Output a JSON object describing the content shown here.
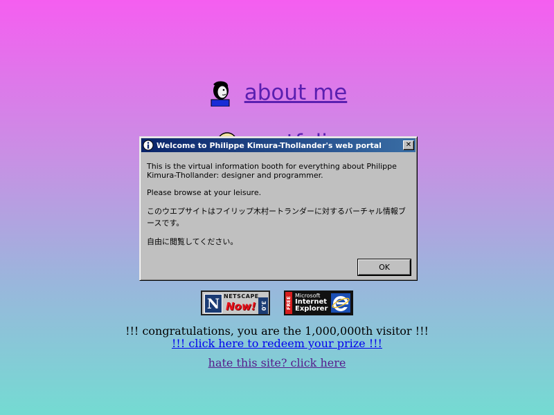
{
  "nav": {
    "about_label": "about me",
    "portfolio_label": "portfolio"
  },
  "dialog": {
    "title": "Welcome to Philippe Kimura-Thollander's web portal",
    "close_glyph": "✕",
    "paragraph_1": "This is the virtual information booth for everything about Philippe Kimura-Thollander: designer and programmer.",
    "paragraph_2": "Please browse at your leisure.",
    "paragraph_3": "このウエプサイトはフイリップ木村ートランダーに対するバーチャル情報ブースです。",
    "paragraph_4": "自由に閲覧してください。",
    "ok_label": "OK"
  },
  "badges": {
    "netscape": {
      "word": "NETSCAPE",
      "now": "Now!",
      "version": "3.0",
      "letter": "N"
    },
    "ie": {
      "free": "FREE",
      "microsoft": "Microsoft",
      "internet": "Internet",
      "explorer": "Explorer"
    }
  },
  "footer": {
    "congrats_text": "!!! congratulations, you are the 1,000,000th visitor !!!",
    "prize_link": "!!! click here to redeem your prize !!!",
    "hate_link": "hate this site? click here"
  },
  "colors": {
    "link_purple": "#5a1fb0",
    "titlebar_start": "#0a246a",
    "titlebar_end": "#3a6ea5",
    "dialog_gray": "#c0c0c0"
  },
  "icons": {
    "about": "person-avatar-icon",
    "portfolio": "smiley-face-icon",
    "dialog": "info-icon"
  }
}
